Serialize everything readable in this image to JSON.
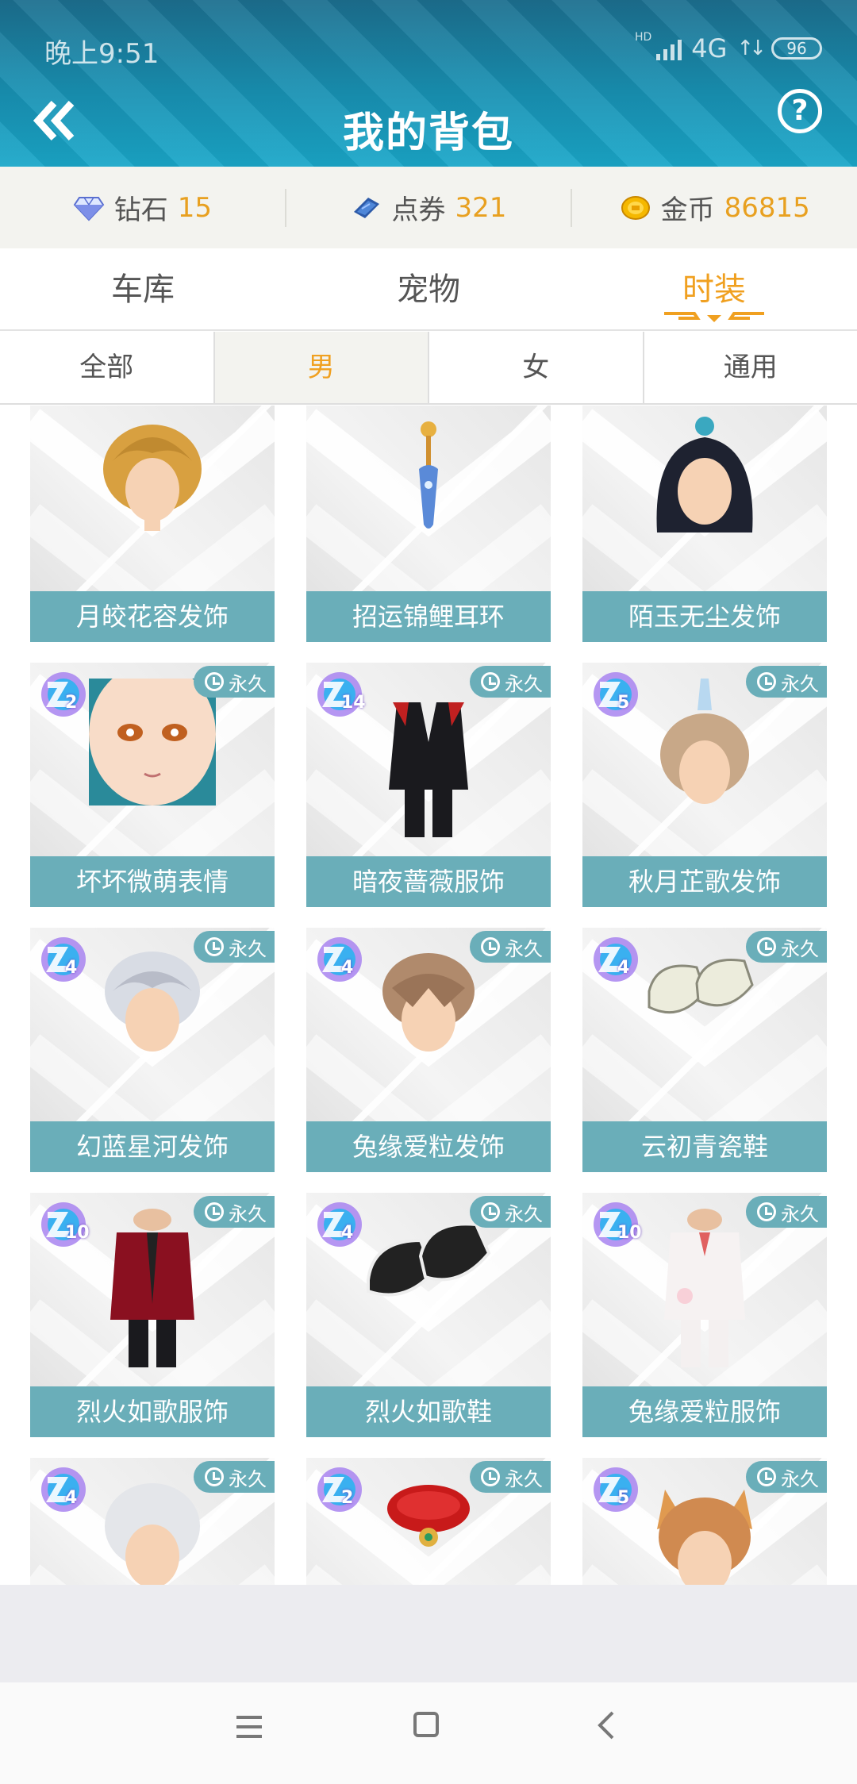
{
  "status_bar": {
    "time": "晚上9:51",
    "hd": "HD",
    "network": "4G",
    "updown": "↑↓",
    "battery": "96"
  },
  "header": {
    "title": "我的背包"
  },
  "currencies": [
    {
      "label": "钻石",
      "value": "15",
      "icon": "diamond-icon"
    },
    {
      "label": "点券",
      "value": "321",
      "icon": "ticket-icon"
    },
    {
      "label": "金币",
      "value": "86815",
      "icon": "coin-icon"
    }
  ],
  "category_tabs": [
    {
      "label": "车库",
      "active": false
    },
    {
      "label": "宠物",
      "active": false
    },
    {
      "label": "时装",
      "active": true
    }
  ],
  "sub_tabs": [
    {
      "label": "全部",
      "active": false
    },
    {
      "label": "男",
      "active": true
    },
    {
      "label": "女",
      "active": false
    },
    {
      "label": "通用",
      "active": false
    }
  ],
  "permanent_label": "永久",
  "items": [
    {
      "name": "月皎花容发饰",
      "level": "",
      "art": "hair-blonde"
    },
    {
      "name": "招运锦鲤耳环",
      "level": "",
      "art": "earring"
    },
    {
      "name": "陌玉无尘发饰",
      "level": "",
      "art": "hair-black"
    },
    {
      "name": "坏坏微萌表情",
      "level": "2",
      "art": "face"
    },
    {
      "name": "暗夜蔷薇服饰",
      "level": "14",
      "art": "suit-black"
    },
    {
      "name": "秋月芷歌发饰",
      "level": "5",
      "art": "hair-light"
    },
    {
      "name": "幻蓝星河发饰",
      "level": "4",
      "art": "hair-silver"
    },
    {
      "name": "兔缘爱粒发饰",
      "level": "4",
      "art": "hair-brown"
    },
    {
      "name": "云初青瓷鞋",
      "level": "4",
      "art": "shoes-white"
    },
    {
      "name": "烈火如歌服饰",
      "level": "10",
      "art": "jacket-red"
    },
    {
      "name": "烈火如歌鞋",
      "level": "4",
      "art": "shoes-black"
    },
    {
      "name": "兔缘爱粒服饰",
      "level": "10",
      "art": "suit-white"
    },
    {
      "name": "",
      "level": "4",
      "art": "hair-white"
    },
    {
      "name": "",
      "level": "2",
      "art": "bracelet-red"
    },
    {
      "name": "",
      "level": "5",
      "art": "hair-cat"
    }
  ],
  "colors": {
    "accent": "#f0a020",
    "label_bg": "#6aaeb9",
    "header": "#1891b3"
  }
}
